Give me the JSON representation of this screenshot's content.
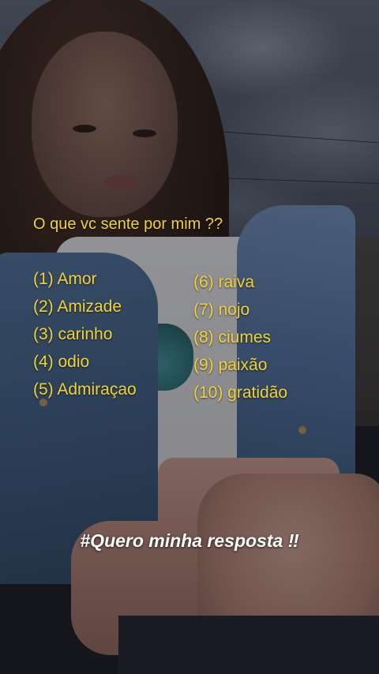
{
  "question": "O que vc sente por mim ??",
  "options_left": [
    "(1) Amor",
    "(2) Amizade",
    "(3) carinho",
    "(4) odio",
    "(5) Admiraçao"
  ],
  "options_right": [
    "(6) raiva",
    "(7) nojo",
    "(8) ciumes",
    "(9) paixão",
    "(10) gratidão"
  ],
  "caption": "#Quero minha resposta ‼",
  "colors": {
    "question_text": "#f0d23a",
    "caption_text": "#ffffff"
  }
}
